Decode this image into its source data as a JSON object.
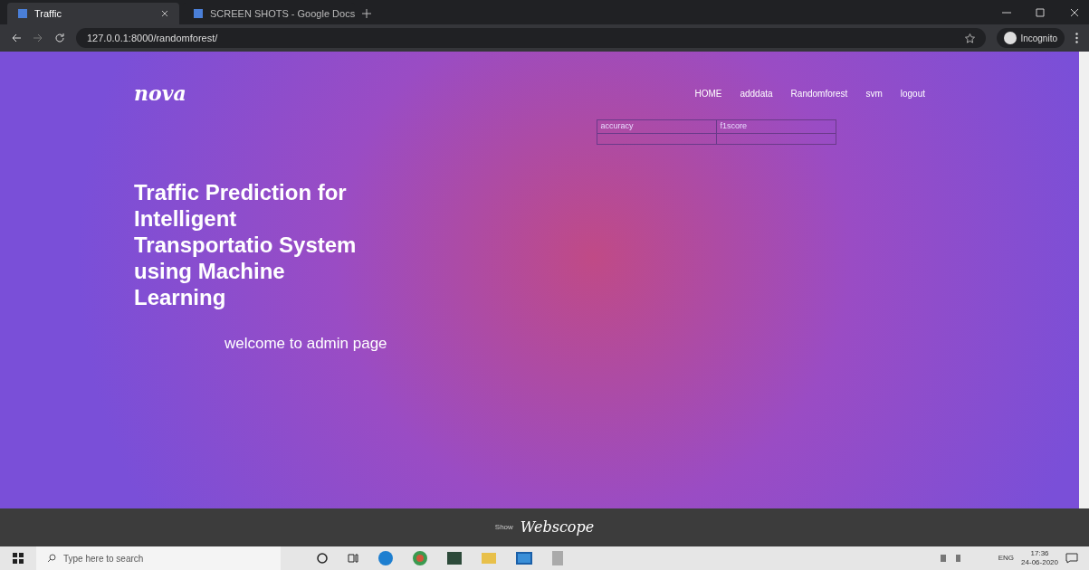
{
  "browser": {
    "tabs": [
      {
        "title": "Traffic",
        "selected": true
      },
      {
        "title": "SCREEN SHOTS - Google Docs",
        "selected": false
      }
    ],
    "address": "127.0.0.1:8000/randomforest/",
    "profile": "Incognito"
  },
  "page": {
    "logo": "nova",
    "nav": [
      "HOME",
      "adddata",
      "Randomforest",
      "svm",
      "logout"
    ],
    "table": {
      "columns": [
        "accuracy",
        "f1score"
      ]
    },
    "headline": "Traffic Prediction for Intelligent Transportatio System using Machine Learning",
    "welcome": "welcome to admin page",
    "footer": {
      "prefix": "Show",
      "brand": "Webscope"
    }
  },
  "taskbar": {
    "search_placeholder": "Type here to search",
    "language": "ENG",
    "time": "17:36",
    "date": "24-06-2020"
  }
}
